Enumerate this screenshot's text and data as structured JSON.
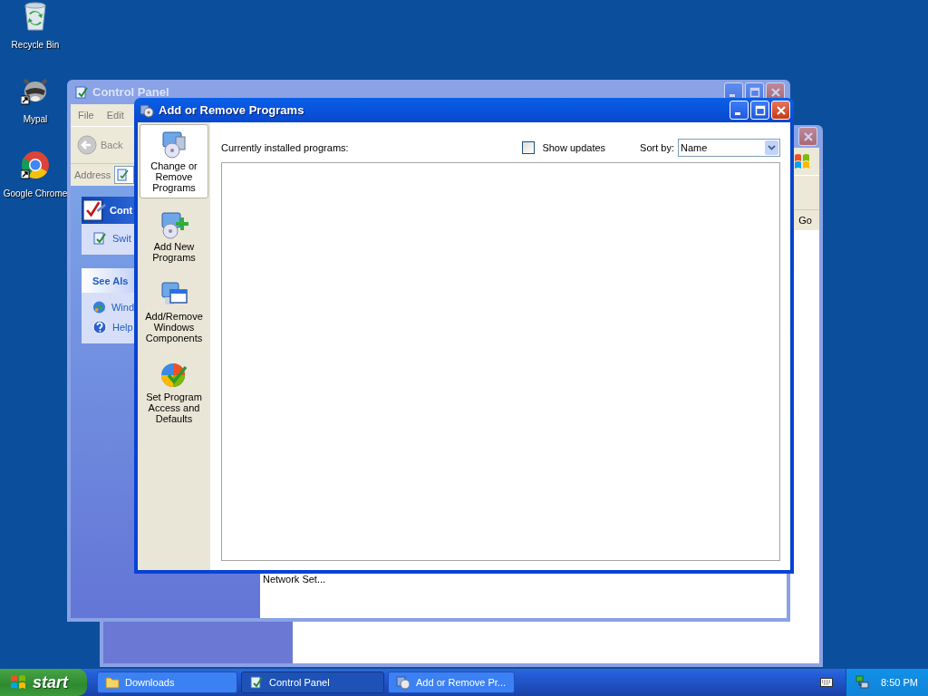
{
  "desktop_icons": [
    {
      "label": "Recycle Bin"
    },
    {
      "label": "Mypal"
    },
    {
      "label": "Google Chrome"
    }
  ],
  "back_window": {
    "go_button": "Go"
  },
  "control_panel": {
    "title": "Control Panel",
    "menu": [
      "File",
      "Edit"
    ],
    "back_button": "Back",
    "address_label": "Address",
    "task_pane": {
      "header": "Cont",
      "item": "Swit"
    },
    "see_also": {
      "header": "See Als",
      "items": [
        "Wind",
        "Help"
      ]
    },
    "content_item": "Network Set..."
  },
  "add_remove": {
    "title": "Add or Remove Programs",
    "sidebar": [
      {
        "label": "Change or Remove Programs",
        "selected": true
      },
      {
        "label": "Add New Programs",
        "selected": false
      },
      {
        "label": "Add/Remove Windows Components",
        "selected": false
      },
      {
        "label": "Set Program Access and Defaults",
        "selected": false
      }
    ],
    "installed_label": "Currently installed programs:",
    "show_updates": {
      "label": "Show updates",
      "checked": false
    },
    "sort_label": "Sort by:",
    "sort_value": "Name"
  },
  "taskbar": {
    "start": "start",
    "tasks": [
      {
        "label": "Downloads",
        "selected": false
      },
      {
        "label": "Control Panel",
        "selected": true
      },
      {
        "label": "Add or Remove Pr...",
        "selected": false
      }
    ],
    "clock": "8:50 PM"
  }
}
